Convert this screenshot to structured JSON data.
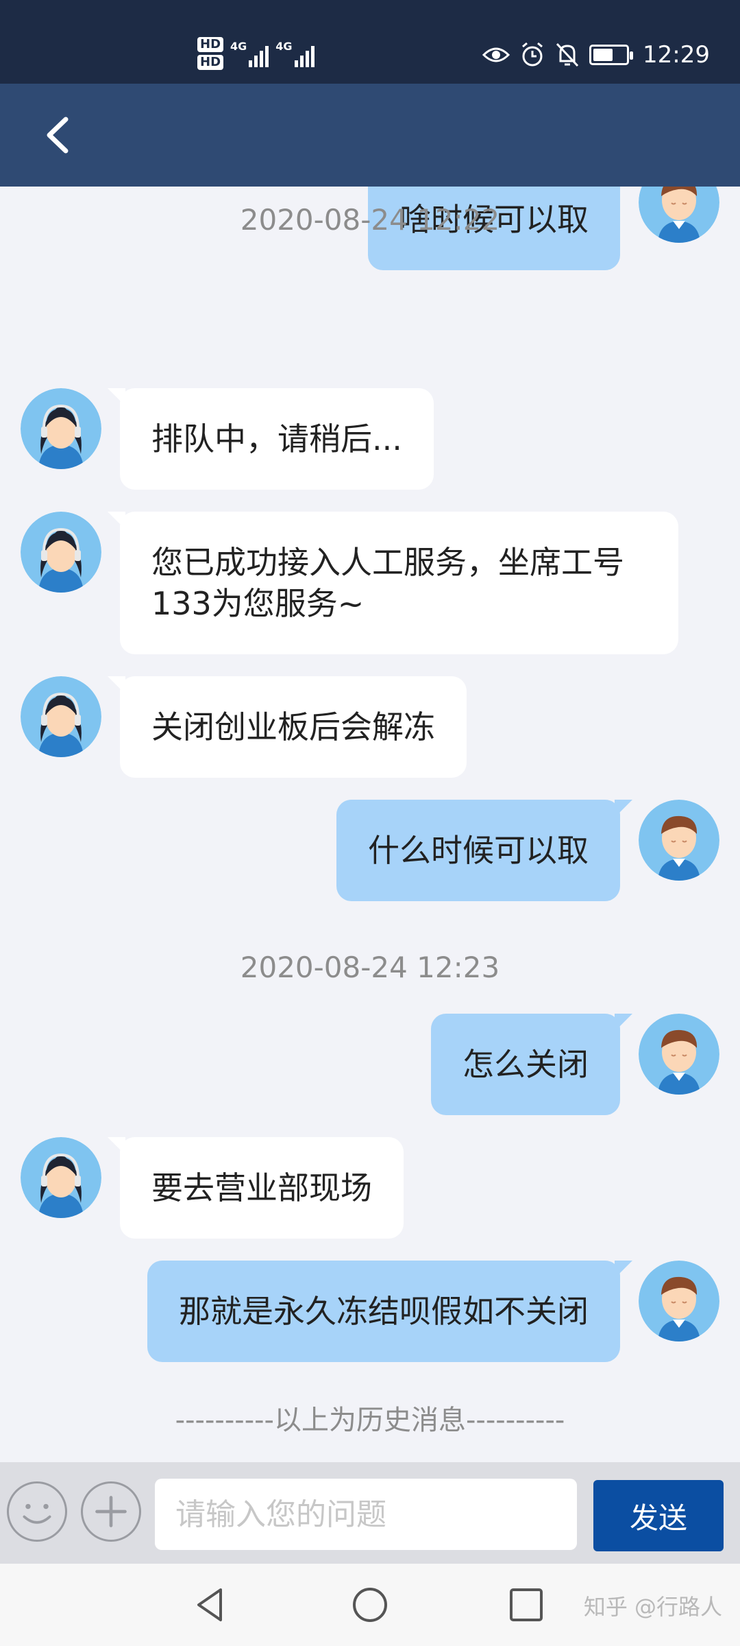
{
  "status_bar": {
    "hd1": "HD",
    "hd2": "HD",
    "net1": "4G",
    "net2": "4G",
    "time": "12:29",
    "battery_level": 0.6,
    "icons": [
      "eye-icon",
      "alarm-icon",
      "bell-off-icon",
      "battery-icon"
    ]
  },
  "nav": {
    "back_icon": "chevron-left-icon"
  },
  "messages": [
    {
      "type": "user",
      "text": "啥时候可以取"
    },
    {
      "type": "timestamp",
      "text": "2020-08-24 12:22"
    },
    {
      "type": "agent",
      "text": "排队中，请稍后..."
    },
    {
      "type": "agent",
      "text": "您已成功接入人工服务，坐席工号133为您服务~"
    },
    {
      "type": "agent",
      "text": "关闭创业板后会解冻"
    },
    {
      "type": "user",
      "text": "什么时候可以取"
    },
    {
      "type": "timestamp",
      "text": "2020-08-24 12:23"
    },
    {
      "type": "user",
      "text": "怎么关闭"
    },
    {
      "type": "agent",
      "text": "要去营业部现场"
    },
    {
      "type": "user",
      "text": "那就是永久冻结呗假如不关闭"
    }
  ],
  "history_divider": "----------以上为历史消息----------",
  "input_bar": {
    "placeholder": "请输入您的问题",
    "value": "",
    "send_label": "发送",
    "emoji_icon": "smiley-icon",
    "plus_icon": "plus-icon"
  },
  "system_nav": {
    "icons": [
      "back-triangle-icon",
      "home-circle-icon",
      "recents-square-icon"
    ],
    "watermark": "知乎 @行路人"
  },
  "colors": {
    "status_bar": "#1d2b45",
    "nav_bar": "#2f4a73",
    "user_bubble": "#a7d3f9",
    "agent_bubble": "#ffffff",
    "send_button": "#0b4ea2",
    "background": "#f2f3f8"
  }
}
